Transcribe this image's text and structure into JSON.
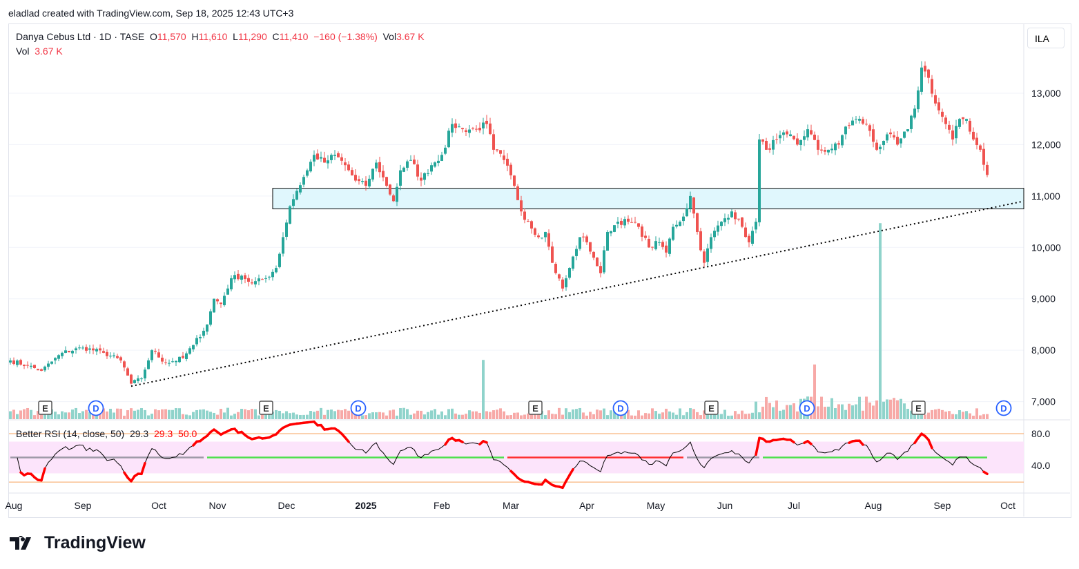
{
  "header": {
    "credit": "eladlad created with TradingView.com, Sep 18, 2025 12:43 UTC+3"
  },
  "legend": {
    "symbol": "Danya Cebus Ltd · 1D · TASE",
    "o_label": "O",
    "o": "11,570",
    "h_label": "H",
    "h": "11,610",
    "l_label": "L",
    "l": "11,290",
    "c_label": "C",
    "c": "11,410",
    "change": "−160 (−1.38%)",
    "vol_label": "Vol",
    "vol": "3.67 K",
    "vol2_label": "Vol",
    "vol2": "3.67 K"
  },
  "rsi_legend": {
    "name": "Better RSI (14, close, 50)",
    "v1": "29.3",
    "v2": "29.3",
    "v3": "50.0"
  },
  "currency": "ILA",
  "logo": "TradingView",
  "colors": {
    "up": "#26a69a",
    "down": "#ef5350",
    "zone": "#e0f7fd",
    "rsi_band": "#fce4fb",
    "level": "#f7a35c"
  },
  "chart_data": {
    "type": "candlestick",
    "title": "Danya Cebus Ltd · 1D · TASE",
    "ylim": [
      6700,
      13800
    ],
    "y_ticks": [
      "13,000",
      "12,000",
      "11,000",
      "10,000",
      "9,000",
      "8,000",
      "7,000"
    ],
    "y_tick_values": [
      13000,
      12000,
      11000,
      10000,
      9000,
      8000,
      7000
    ],
    "x_ticks": [
      {
        "label": "Aug",
        "bar": 0
      },
      {
        "label": "Sep",
        "bar": 21
      },
      {
        "label": "Oct",
        "bar": 43
      },
      {
        "label": "Nov",
        "bar": 60
      },
      {
        "label": "Dec",
        "bar": 80
      },
      {
        "label": "2025",
        "bar": 103,
        "bold": true
      },
      {
        "label": "Feb",
        "bar": 125
      },
      {
        "label": "Mar",
        "bar": 145
      },
      {
        "label": "Apr",
        "bar": 167
      },
      {
        "label": "May",
        "bar": 187
      },
      {
        "label": "Jun",
        "bar": 207
      },
      {
        "label": "Jul",
        "bar": 227
      },
      {
        "label": "Aug",
        "bar": 250
      },
      {
        "label": "Sep",
        "bar": 270
      },
      {
        "label": "Oct",
        "bar": 289
      }
    ],
    "close_anchors": [
      [
        0,
        7800
      ],
      [
        5,
        7700
      ],
      [
        9,
        7600
      ],
      [
        15,
        7950
      ],
      [
        21,
        8050
      ],
      [
        27,
        7950
      ],
      [
        32,
        7800
      ],
      [
        35,
        7350
      ],
      [
        38,
        7450
      ],
      [
        41,
        8000
      ],
      [
        45,
        7750
      ],
      [
        50,
        7850
      ],
      [
        53,
        8100
      ],
      [
        57,
        8500
      ],
      [
        59,
        9000
      ],
      [
        61,
        8900
      ],
      [
        64,
        9400
      ],
      [
        67,
        9450
      ],
      [
        70,
        9300
      ],
      [
        74,
        9400
      ],
      [
        77,
        9600
      ],
      [
        79,
        10200
      ],
      [
        81,
        10800
      ],
      [
        83,
        11100
      ],
      [
        86,
        11500
      ],
      [
        88,
        11800
      ],
      [
        91,
        11650
      ],
      [
        94,
        11800
      ],
      [
        97,
        11600
      ],
      [
        100,
        11300
      ],
      [
        103,
        11200
      ],
      [
        106,
        11650
      ],
      [
        109,
        11200
      ],
      [
        111,
        10900
      ],
      [
        113,
        11500
      ],
      [
        116,
        11700
      ],
      [
        119,
        11300
      ],
      [
        122,
        11600
      ],
      [
        125,
        11800
      ],
      [
        128,
        12400
      ],
      [
        131,
        12300
      ],
      [
        135,
        12300
      ],
      [
        138,
        12400
      ],
      [
        140,
        11900
      ],
      [
        143,
        11700
      ],
      [
        146,
        11200
      ],
      [
        148,
        10700
      ],
      [
        150,
        10500
      ],
      [
        153,
        10200
      ],
      [
        155,
        10300
      ],
      [
        157,
        9700
      ],
      [
        160,
        9200
      ],
      [
        162,
        9600
      ],
      [
        165,
        10200
      ],
      [
        167,
        10100
      ],
      [
        169,
        9800
      ],
      [
        171,
        9500
      ],
      [
        173,
        10300
      ],
      [
        176,
        10500
      ],
      [
        179,
        10500
      ],
      [
        182,
        10400
      ],
      [
        185,
        10000
      ],
      [
        188,
        10100
      ],
      [
        190,
        9900
      ],
      [
        192,
        10400
      ],
      [
        195,
        10600
      ],
      [
        197,
        11000
      ],
      [
        199,
        10300
      ],
      [
        201,
        9700
      ],
      [
        203,
        10200
      ],
      [
        206,
        10500
      ],
      [
        209,
        10700
      ],
      [
        212,
        10400
      ],
      [
        214,
        10100
      ],
      [
        216,
        10500
      ],
      [
        217,
        12100
      ],
      [
        219,
        11900
      ],
      [
        222,
        12100
      ],
      [
        225,
        12200
      ],
      [
        228,
        12000
      ],
      [
        231,
        12300
      ],
      [
        234,
        11900
      ],
      [
        237,
        11900
      ],
      [
        240,
        12000
      ],
      [
        242,
        12350
      ],
      [
        245,
        12500
      ],
      [
        248,
        12400
      ],
      [
        251,
        11900
      ],
      [
        254,
        12200
      ],
      [
        257,
        12000
      ],
      [
        260,
        12300
      ],
      [
        262,
        12700
      ],
      [
        264,
        13500
      ],
      [
        266,
        13300
      ],
      [
        268,
        12800
      ],
      [
        271,
        12400
      ],
      [
        273,
        12100
      ],
      [
        275,
        12500
      ],
      [
        277,
        12500
      ],
      [
        279,
        12100
      ],
      [
        281,
        11900
      ],
      [
        283,
        11410
      ]
    ],
    "volume_spikes": [
      [
        137,
        5200
      ],
      [
        252,
        8600
      ],
      [
        233,
        2400
      ]
    ],
    "earnings_bars": [
      5,
      69,
      147,
      198,
      258
    ],
    "dividend_bars": [
      18,
      94,
      170,
      224,
      281
    ],
    "zone": {
      "top": 11150,
      "bottom": 10750,
      "from_bar": 76
    },
    "trendline": [
      [
        35,
        7300
      ],
      [
        294,
        10900
      ]
    ],
    "rsi": {
      "ylim": [
        0,
        100
      ],
      "levels": [
        80,
        70,
        50,
        30,
        19
      ],
      "tick_labels": [
        "80.0",
        "40.0"
      ],
      "tick_values": [
        80,
        40
      ],
      "period": 14,
      "last": 29.3
    }
  }
}
